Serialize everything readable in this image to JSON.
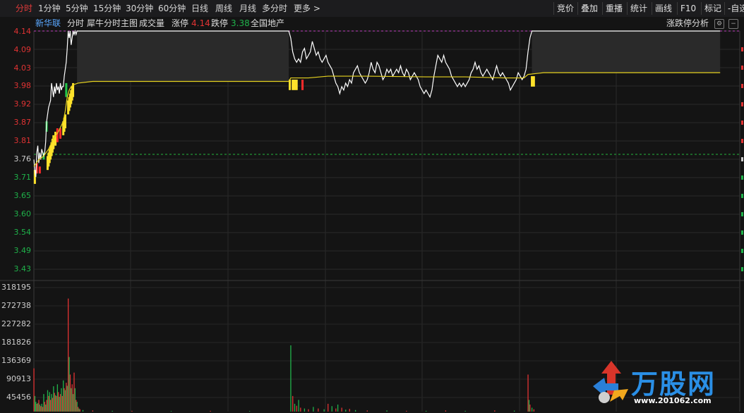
{
  "toolbar": {
    "tabs": [
      "分时",
      "1分钟",
      "5分钟",
      "15分钟",
      "30分钟",
      "60分钟",
      "日线",
      "周线",
      "月线",
      "多分时",
      "更多 >"
    ],
    "active_tab": "分时",
    "right_buttons": [
      "竞价",
      "叠加",
      "重播",
      "统计",
      "画线",
      "F10",
      "标记",
      "-自选"
    ]
  },
  "info": {
    "stock_name": "新华联",
    "chart_mode": "分时",
    "indicator": "犀牛分时主图",
    "volume_label": "成交量",
    "limit_up_label": "涨停",
    "limit_up_value": "4.14",
    "limit_down_label": "跌停",
    "limit_down_value": "3.38",
    "sector": "全国地产",
    "analysis_button": "涨跌停分析"
  },
  "price_axis": [
    "4.14",
    "4.09",
    "4.03",
    "3.98",
    "3.92",
    "3.87",
    "3.81",
    "3.76",
    "3.71",
    "3.65",
    "3.60",
    "3.54",
    "3.49",
    "3.43"
  ],
  "volume_axis": [
    "318195",
    "272738",
    "227282",
    "181826",
    "136369",
    "90913",
    "45456"
  ],
  "watermark": {
    "brand": "万股网",
    "url": "www.201062.com"
  },
  "chart_data": {
    "type": "line",
    "title": "",
    "prev_close": 3.785,
    "ylim": [
      3.43,
      4.14
    ],
    "limit_up": 4.14,
    "series": [
      {
        "name": "",
        "role": "price",
        "color": "#ffffff",
        "values": [
          [
            0,
            3.77
          ],
          [
            1,
            3.74
          ],
          [
            2,
            3.72
          ],
          [
            3,
            3.79
          ],
          [
            4,
            3.81
          ],
          [
            5,
            3.76
          ],
          [
            6,
            3.79
          ],
          [
            7,
            3.77
          ],
          [
            8,
            3.8
          ],
          [
            9,
            3.79
          ],
          [
            10,
            3.78
          ],
          [
            11,
            3.79
          ],
          [
            12,
            3.82
          ],
          [
            13,
            3.88
          ],
          [
            14,
            3.9
          ],
          [
            15,
            3.92
          ],
          [
            16,
            3.93
          ],
          [
            17,
            3.94
          ],
          [
            18,
            3.99
          ],
          [
            19,
            3.97
          ],
          [
            20,
            3.95
          ],
          [
            21,
            3.98
          ],
          [
            22,
            3.96
          ],
          [
            23,
            3.99
          ],
          [
            24,
            3.97
          ],
          [
            25,
            3.98
          ],
          [
            26,
            3.96
          ],
          [
            27,
            3.99
          ],
          [
            28,
            3.97
          ],
          [
            29,
            3.98
          ],
          [
            30,
            3.98
          ],
          [
            31,
            4.01
          ],
          [
            32,
            4.03
          ],
          [
            33,
            4.05
          ],
          [
            34,
            4.09
          ],
          [
            35,
            4.14
          ],
          [
            36,
            4.12
          ],
          [
            37,
            4.14
          ],
          [
            38,
            4.1
          ],
          [
            39,
            4.12
          ],
          [
            40,
            4.14
          ],
          [
            41,
            4.13
          ],
          [
            42,
            4.14
          ],
          [
            43,
            4.13
          ],
          [
            44,
            4.14
          ],
          [
            45,
            4.14
          ],
          [
            60,
            4.14
          ],
          [
            90,
            4.14
          ],
          [
            130,
            4.14
          ],
          [
            170,
            4.14
          ],
          [
            200,
            4.14
          ],
          [
            220,
            4.14
          ],
          [
            240,
            4.14
          ],
          [
            258,
            4.14
          ],
          [
            260,
            4.14
          ],
          [
            262,
            4.12
          ],
          [
            264,
            4.08
          ],
          [
            266,
            4.06
          ],
          [
            268,
            4.05
          ],
          [
            270,
            4.06
          ],
          [
            272,
            4.05
          ],
          [
            274,
            4.08
          ],
          [
            276,
            4.09
          ],
          [
            278,
            4.06
          ],
          [
            280,
            4.07
          ],
          [
            282,
            4.08
          ],
          [
            284,
            4.11
          ],
          [
            286,
            4.09
          ],
          [
            288,
            4.07
          ],
          [
            290,
            4.08
          ],
          [
            292,
            4.06
          ],
          [
            294,
            4.05
          ],
          [
            296,
            4.06
          ],
          [
            298,
            4.07
          ],
          [
            300,
            4.05
          ],
          [
            302,
            4.04
          ],
          [
            304,
            4.03
          ],
          [
            306,
            4.01
          ],
          [
            308,
            3.99
          ],
          [
            310,
            3.98
          ],
          [
            312,
            3.96
          ],
          [
            314,
            3.98
          ],
          [
            316,
            3.97
          ],
          [
            318,
            3.99
          ],
          [
            320,
            3.98
          ],
          [
            322,
            4.0
          ],
          [
            324,
            3.99
          ],
          [
            326,
            4.02
          ],
          [
            328,
            4.03
          ],
          [
            330,
            4.04
          ],
          [
            332,
            4.02
          ],
          [
            334,
            4.01
          ],
          [
            336,
            4.0
          ],
          [
            338,
            3.99
          ],
          [
            340,
            4.0
          ],
          [
            342,
            4.02
          ],
          [
            344,
            4.05
          ],
          [
            346,
            4.03
          ],
          [
            348,
            4.02
          ],
          [
            350,
            4.05
          ],
          [
            352,
            4.04
          ],
          [
            354,
            4.02
          ],
          [
            356,
            4.0
          ],
          [
            358,
            4.01
          ],
          [
            360,
            4.03
          ],
          [
            362,
            4.02
          ],
          [
            364,
            4.03
          ],
          [
            366,
            4.01
          ],
          [
            368,
            4.02
          ],
          [
            370,
            4.03
          ],
          [
            372,
            4.02
          ],
          [
            374,
            4.04
          ],
          [
            376,
            4.02
          ],
          [
            378,
            4.01
          ],
          [
            380,
            4.03
          ],
          [
            382,
            4.02
          ],
          [
            384,
            4.0
          ],
          [
            386,
            4.01
          ],
          [
            388,
            4.02
          ],
          [
            390,
            4.01
          ],
          [
            392,
            4.0
          ],
          [
            394,
            3.98
          ],
          [
            396,
            3.97
          ],
          [
            398,
            3.96
          ],
          [
            400,
            3.97
          ],
          [
            402,
            3.96
          ],
          [
            404,
            3.95
          ],
          [
            406,
            3.97
          ],
          [
            408,
            4.01
          ],
          [
            410,
            4.04
          ],
          [
            412,
            4.07
          ],
          [
            414,
            4.06
          ],
          [
            416,
            4.05
          ],
          [
            418,
            4.07
          ],
          [
            420,
            4.05
          ],
          [
            422,
            4.04
          ],
          [
            424,
            4.03
          ],
          [
            426,
            4.01
          ],
          [
            428,
            4.0
          ],
          [
            430,
            3.99
          ],
          [
            432,
            3.98
          ],
          [
            434,
            3.99
          ],
          [
            436,
            3.98
          ],
          [
            438,
            3.99
          ],
          [
            440,
            3.98
          ],
          [
            442,
            3.99
          ],
          [
            444,
            4.0
          ],
          [
            446,
            4.02
          ],
          [
            448,
            4.03
          ],
          [
            450,
            4.05
          ],
          [
            452,
            4.03
          ],
          [
            454,
            4.04
          ],
          [
            456,
            4.02
          ],
          [
            458,
            4.01
          ],
          [
            460,
            4.02
          ],
          [
            462,
            4.03
          ],
          [
            464,
            4.02
          ],
          [
            466,
            4.01
          ],
          [
            468,
            4.0
          ],
          [
            470,
            4.02
          ],
          [
            472,
            4.04
          ],
          [
            474,
            4.02
          ],
          [
            476,
            4.01
          ],
          [
            478,
            4.02
          ],
          [
            480,
            4.01
          ],
          [
            482,
            4.0
          ],
          [
            484,
            3.99
          ],
          [
            486,
            3.97
          ],
          [
            488,
            3.98
          ],
          [
            490,
            3.99
          ],
          [
            492,
            4.0
          ],
          [
            494,
            4.02
          ],
          [
            496,
            4.01
          ],
          [
            498,
            4.0
          ],
          [
            500,
            4.01
          ],
          [
            502,
            4.03
          ],
          [
            504,
            4.08
          ],
          [
            506,
            4.12
          ],
          [
            508,
            4.14
          ],
          [
            510,
            4.14
          ],
          [
            540,
            4.14
          ],
          [
            580,
            4.14
          ],
          [
            620,
            4.14
          ],
          [
            660,
            4.14
          ],
          [
            700,
            4.14
          ]
        ]
      },
      {
        "name": "",
        "role": "average",
        "color": "#e6d21f",
        "values": [
          [
            0,
            3.75
          ],
          [
            5,
            3.77
          ],
          [
            10,
            3.78
          ],
          [
            15,
            3.8
          ],
          [
            20,
            3.83
          ],
          [
            25,
            3.85
          ],
          [
            30,
            3.88
          ],
          [
            32,
            3.91
          ],
          [
            34,
            3.95
          ],
          [
            36,
            3.97
          ],
          [
            38,
            3.98
          ],
          [
            40,
            3.985
          ],
          [
            45,
            3.99
          ],
          [
            60,
            3.995
          ],
          [
            100,
            3.995
          ],
          [
            200,
            3.995
          ],
          [
            260,
            3.995
          ],
          [
            262,
            4.005
          ],
          [
            280,
            4.005
          ],
          [
            300,
            4.01
          ],
          [
            340,
            4.01
          ],
          [
            400,
            4.008
          ],
          [
            440,
            4.008
          ],
          [
            480,
            4.005
          ],
          [
            500,
            4.005
          ],
          [
            504,
            4.015
          ],
          [
            520,
            4.02
          ],
          [
            600,
            4.02
          ],
          [
            700,
            4.02
          ]
        ]
      }
    ],
    "volume": {
      "ylim": [
        0,
        318195
      ],
      "bars": [
        [
          0,
          0,
          111000
        ],
        [
          1,
          1,
          40000
        ],
        [
          2,
          1,
          25000
        ],
        [
          3,
          0,
          20000
        ],
        [
          4,
          1,
          22000
        ],
        [
          5,
          0,
          30000
        ],
        [
          6,
          1,
          18000
        ],
        [
          7,
          0,
          14000
        ],
        [
          8,
          1,
          20000
        ],
        [
          9,
          0,
          12000
        ],
        [
          10,
          1,
          45000
        ],
        [
          11,
          0,
          25000
        ],
        [
          12,
          1,
          18000
        ],
        [
          13,
          0,
          30000
        ],
        [
          14,
          1,
          55000
        ],
        [
          15,
          0,
          40000
        ],
        [
          16,
          1,
          50000
        ],
        [
          17,
          0,
          30000
        ],
        [
          18,
          1,
          45000
        ],
        [
          19,
          0,
          35000
        ],
        [
          20,
          1,
          65000
        ],
        [
          21,
          0,
          48000
        ],
        [
          22,
          1,
          42000
        ],
        [
          23,
          0,
          40000
        ],
        [
          24,
          1,
          70000
        ],
        [
          25,
          0,
          50000
        ],
        [
          26,
          1,
          38000
        ],
        [
          27,
          0,
          45000
        ],
        [
          28,
          1,
          60000
        ],
        [
          29,
          0,
          40000
        ],
        [
          30,
          1,
          80000
        ],
        [
          31,
          0,
          60000
        ],
        [
          32,
          1,
          55000
        ],
        [
          33,
          0,
          74000
        ],
        [
          34,
          1,
          66000
        ],
        [
          35,
          0,
          290000
        ],
        [
          36,
          1,
          140000
        ],
        [
          37,
          0,
          95000
        ],
        [
          38,
          1,
          60000
        ],
        [
          39,
          0,
          70000
        ],
        [
          40,
          1,
          45000
        ],
        [
          41,
          0,
          100000
        ],
        [
          42,
          1,
          60000
        ],
        [
          43,
          0,
          30000
        ],
        [
          44,
          1,
          25000
        ],
        [
          45,
          0,
          12000
        ],
        [
          46,
          1,
          8000
        ],
        [
          47,
          0,
          6000
        ],
        [
          50,
          1,
          4000
        ],
        [
          60,
          0,
          3000
        ],
        [
          80,
          1,
          2000
        ],
        [
          100,
          0,
          2000
        ],
        [
          140,
          1,
          1500
        ],
        [
          180,
          0,
          2000
        ],
        [
          220,
          1,
          1500
        ],
        [
          262,
          1,
          170000
        ],
        [
          264,
          0,
          40000
        ],
        [
          266,
          1,
          20000
        ],
        [
          268,
          0,
          15000
        ],
        [
          270,
          1,
          30000
        ],
        [
          272,
          0,
          10000
        ],
        [
          276,
          1,
          8000
        ],
        [
          280,
          0,
          6000
        ],
        [
          285,
          1,
          12000
        ],
        [
          290,
          0,
          8000
        ],
        [
          296,
          1,
          6000
        ],
        [
          300,
          0,
          20000
        ],
        [
          304,
          1,
          14000
        ],
        [
          308,
          0,
          8000
        ],
        [
          310,
          1,
          18000
        ],
        [
          314,
          0,
          10000
        ],
        [
          318,
          1,
          5000
        ],
        [
          322,
          0,
          7000
        ],
        [
          328,
          1,
          4000
        ],
        [
          340,
          0,
          3000
        ],
        [
          360,
          1,
          3000
        ],
        [
          380,
          0,
          2000
        ],
        [
          400,
          1,
          2000
        ],
        [
          420,
          0,
          3000
        ],
        [
          440,
          1,
          2000
        ],
        [
          470,
          0,
          3000
        ],
        [
          490,
          1,
          2500
        ],
        [
          504,
          0,
          95000
        ],
        [
          505,
          1,
          30000
        ],
        [
          506,
          0,
          18000
        ],
        [
          508,
          1,
          10000
        ],
        [
          510,
          0,
          6000
        ]
      ]
    }
  }
}
